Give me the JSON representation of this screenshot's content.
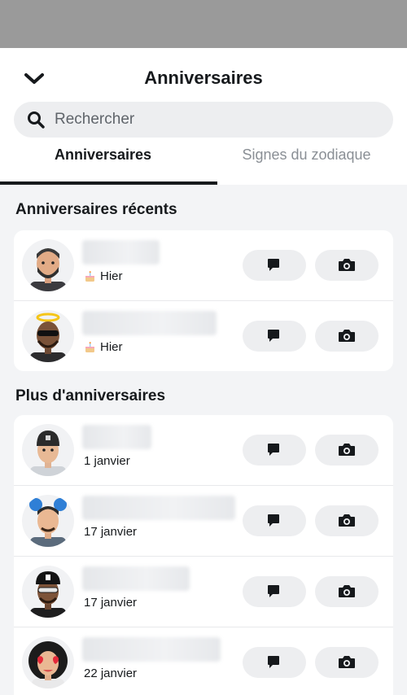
{
  "header": {
    "title": "Anniversaires"
  },
  "search": {
    "placeholder": "Rechercher"
  },
  "tabs": [
    {
      "label": "Anniversaires",
      "active": true
    },
    {
      "label": "Signes du zodiaque",
      "active": false
    }
  ],
  "sections": [
    {
      "title": "Anniversaires récents",
      "items": [
        {
          "date_label": "Hier",
          "has_cake": true
        },
        {
          "date_label": "Hier",
          "has_cake": true
        }
      ]
    },
    {
      "title": "Plus d'anniversaires",
      "items": [
        {
          "date_label": "1 janvier",
          "has_cake": false
        },
        {
          "date_label": "17 janvier",
          "has_cake": false
        },
        {
          "date_label": "17 janvier",
          "has_cake": false
        },
        {
          "date_label": "22 janvier",
          "has_cake": false
        }
      ]
    }
  ],
  "actions": {
    "chat_icon": "chat-icon",
    "camera_icon": "camera-icon"
  },
  "colors": {
    "text": "#16191c",
    "muted": "#8a8f95",
    "pill": "#edeef0",
    "background": "#f3f4f6",
    "topbar": "#9a9a9a"
  }
}
